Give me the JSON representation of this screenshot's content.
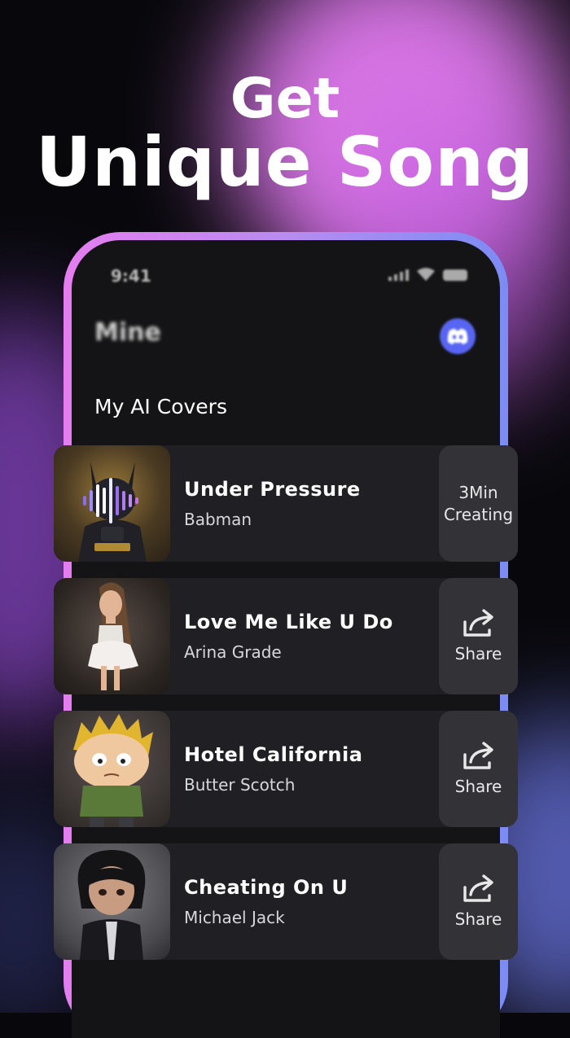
{
  "headline": {
    "line1": "Get",
    "line2": "Unique Song"
  },
  "status_bar": {
    "time": "9:41"
  },
  "header": {
    "title": "Mine",
    "discord_icon": "discord-icon"
  },
  "section": {
    "title": "My AI Covers"
  },
  "songs": [
    {
      "title": "Under Pressure",
      "artist": "Babman",
      "action": "creating",
      "action_line1": "3Min",
      "action_line2": "Creating"
    },
    {
      "title": "Love Me Like U Do",
      "artist": "Arina Grade",
      "action": "share",
      "action_label": "Share"
    },
    {
      "title": "Hotel California",
      "artist": "Butter Scotch",
      "action": "share",
      "action_label": "Share"
    },
    {
      "title": "Cheating On U",
      "artist": "Michael Jack",
      "action": "share",
      "action_label": "Share"
    }
  ],
  "colors": {
    "glow_pink": "#e27af0",
    "glow_blue": "#6d78e8",
    "card_bg": "#1f1f24",
    "action_bg": "#323237",
    "discord": "#5865f2"
  }
}
